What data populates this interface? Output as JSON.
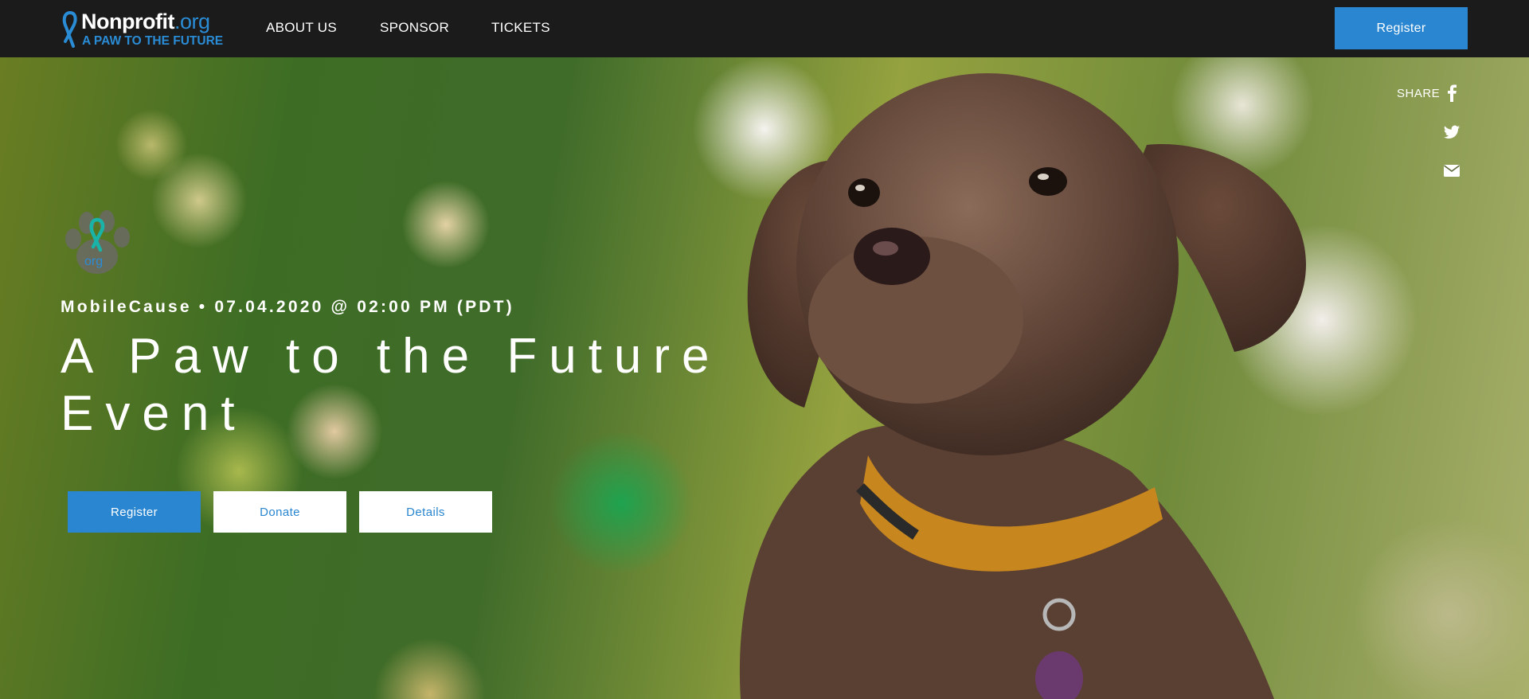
{
  "brand": {
    "name": "Nonprofit",
    "domain": ".org",
    "tagline": "A PAW TO THE FUTURE"
  },
  "nav": {
    "links": [
      "ABOUT US",
      "SPONSOR",
      "TICKETS"
    ],
    "register_label": "Register"
  },
  "share": {
    "label": "SHARE",
    "icons": [
      "facebook-icon",
      "twitter-icon",
      "email-icon"
    ]
  },
  "event": {
    "badge_text": "org",
    "meta": "MobileCause • 07.04.2020 @ 02:00 PM (PDT)",
    "title": "A Paw to the Future Event"
  },
  "actions": {
    "register_label": "Register",
    "donate_label": "Donate",
    "details_label": "Details"
  },
  "colors": {
    "accent": "#2a86d0",
    "nav_bg": "#1b1b1b",
    "teal": "#1ab3a8"
  }
}
